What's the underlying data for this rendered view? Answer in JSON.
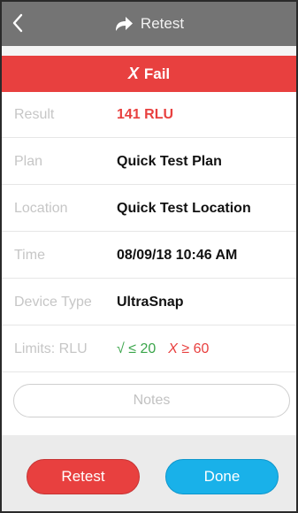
{
  "header": {
    "title": "Retest",
    "back_icon": "chevron-left-icon",
    "title_icon": "share-arrow-icon"
  },
  "status": {
    "icon": "x-icon",
    "mark": "X",
    "label": "Fail"
  },
  "details": [
    {
      "key": "result",
      "label": "Result",
      "value": "141 RLU"
    },
    {
      "key": "plan",
      "label": "Plan",
      "value": "Quick Test Plan"
    },
    {
      "key": "location",
      "label": "Location",
      "value": "Quick Test Location"
    },
    {
      "key": "time",
      "label": "Time",
      "value": "08/09/18 10:46 AM"
    },
    {
      "key": "device_type",
      "label": "Device Type",
      "value": "UltraSnap"
    }
  ],
  "limits": {
    "label": "Limits: RLU",
    "pass_mark": "√",
    "pass_text": "≤ 20",
    "fail_mark": "X",
    "fail_text": "≥ 60"
  },
  "notes": {
    "label": "Notes"
  },
  "footer": {
    "retest_label": "Retest",
    "done_label": "Done"
  },
  "colors": {
    "header_bg": "#747474",
    "fail_red": "#e8403f",
    "pass_green": "#3aa54a",
    "done_blue": "#19b1e9"
  }
}
